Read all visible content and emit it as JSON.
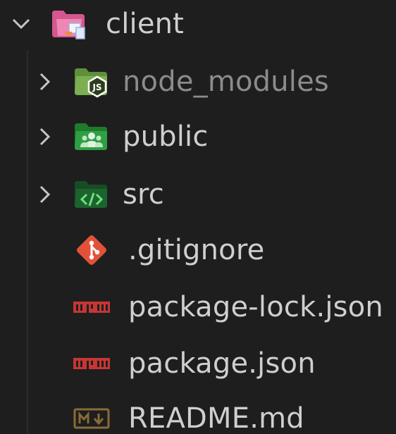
{
  "explorer": {
    "root": {
      "label": "client",
      "icon": "folder-client-icon",
      "expanded": true
    },
    "items": [
      {
        "label": "node_modules",
        "type": "folder",
        "icon": "folder-node-icon",
        "expanded": false
      },
      {
        "label": "public",
        "type": "folder",
        "icon": "folder-public-icon",
        "expanded": false
      },
      {
        "label": "src",
        "type": "folder",
        "icon": "folder-src-icon",
        "expanded": false
      },
      {
        "label": ".gitignore",
        "type": "file",
        "icon": "git-icon"
      },
      {
        "label": "package-lock.json",
        "type": "file",
        "icon": "npm-icon"
      },
      {
        "label": "package.json",
        "type": "file",
        "icon": "npm-icon"
      },
      {
        "label": "README.md",
        "type": "file",
        "icon": "markdown-icon"
      }
    ]
  },
  "colors": {
    "background": "#1e1e1e",
    "text": "#cccccc",
    "dim_text": "#8c8c8c",
    "client_folder": "#e0609a",
    "node_folder": "#6c9e44",
    "public_folder": "#2e8b3a",
    "src_folder": "#1b5e2a",
    "git": "#e4513a",
    "npm": "#c53635",
    "markdown": "#8a6a3a"
  }
}
